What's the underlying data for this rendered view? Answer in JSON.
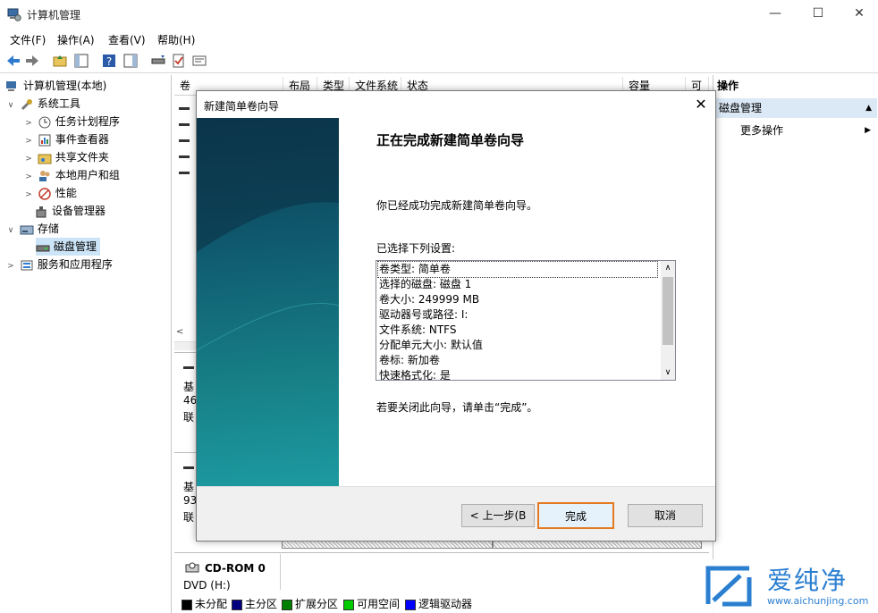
{
  "window": {
    "title": "计算机管理",
    "minimize": "—",
    "maximize": "☐",
    "close": "✕"
  },
  "menu": [
    "文件(F)",
    "操作(A)",
    "查看(V)",
    "帮助(H)"
  ],
  "tree": {
    "root": "计算机管理(本地)",
    "system_tools": "系统工具",
    "task_scheduler": "任务计划程序",
    "event_viewer": "事件查看器",
    "shared_folders": "共享文件夹",
    "local_users": "本地用户和组",
    "performance": "性能",
    "device_manager": "设备管理器",
    "storage": "存储",
    "disk_management": "磁盘管理",
    "services_apps": "服务和应用程序"
  },
  "columns": [
    "卷",
    "布局",
    "类型",
    "文件系统",
    "状态",
    "容量",
    "可"
  ],
  "disks": {
    "disk_a_prefix": "基",
    "disk_a_size": "46",
    "disk_a_state": "联",
    "disk_b_prefix": "基",
    "disk_b_size": "93",
    "disk_b_state": "联",
    "cdrom_name": "CD-ROM 0",
    "cdrom_type": "DVD (H:)"
  },
  "legend": [
    {
      "label": "未分配",
      "color": "#000000"
    },
    {
      "label": "主分区",
      "color": "#00007f"
    },
    {
      "label": "扩展分区",
      "color": "#007f00"
    },
    {
      "label": "可用空间",
      "color": "#00cc00"
    },
    {
      "label": "逻辑驱动器",
      "color": "#0000ff"
    }
  ],
  "actions": {
    "header": "操作",
    "section": "磁盘管理",
    "more": "更多操作"
  },
  "dialog": {
    "title": "新建简单卷向导",
    "heading": "正在完成新建简单卷向导",
    "success_text": "你已经成功完成新建简单卷向导。",
    "settings_label": "已选择下列设置:",
    "settings": [
      "卷类型: 简单卷",
      "选择的磁盘: 磁盘 1",
      "卷大小: 249999 MB",
      "驱动器号或路径: I:",
      "文件系统: NTFS",
      "分配单元大小: 默认值",
      "卷标: 新加卷",
      "快速格式化: 是"
    ],
    "close_hint": "若要关闭此向导，请单击“完成”。",
    "back_button": "< 上一步(B",
    "finish_button": "完成",
    "cancel_button": "取消"
  },
  "watermark": {
    "brand": "爱纯净",
    "url": "www.aichunjing.com"
  },
  "colors": {
    "accent_orange": "#e27a21",
    "selection": "#cce4f7",
    "banner": "#177f86"
  }
}
